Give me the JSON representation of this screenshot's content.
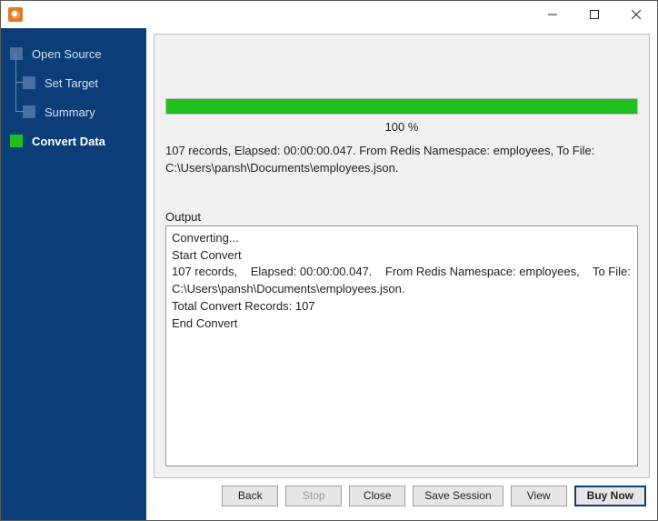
{
  "sidebar": {
    "items": [
      {
        "label": "Open Source",
        "active": false
      },
      {
        "label": "Set Target",
        "active": false
      },
      {
        "label": "Summary",
        "active": false
      },
      {
        "label": "Convert Data",
        "active": true
      }
    ]
  },
  "progress": {
    "pct": 100,
    "pct_label": "100 %"
  },
  "summary_text": "107 records,    Elapsed: 00:00:00.047.    From Redis Namespace: employees,    To File: C:\\Users\\pansh\\Documents\\employees.json.",
  "output_label": "Output",
  "output_text": "Converting...\nStart Convert\n107 records,    Elapsed: 00:00:00.047.    From Redis Namespace: employees,    To File: C:\\Users\\pansh\\Documents\\employees.json.\nTotal Convert Records: 107\nEnd Convert",
  "buttons": {
    "back": "Back",
    "stop": "Stop",
    "close": "Close",
    "save_session": "Save Session",
    "view": "View",
    "buy_now": "Buy Now"
  }
}
